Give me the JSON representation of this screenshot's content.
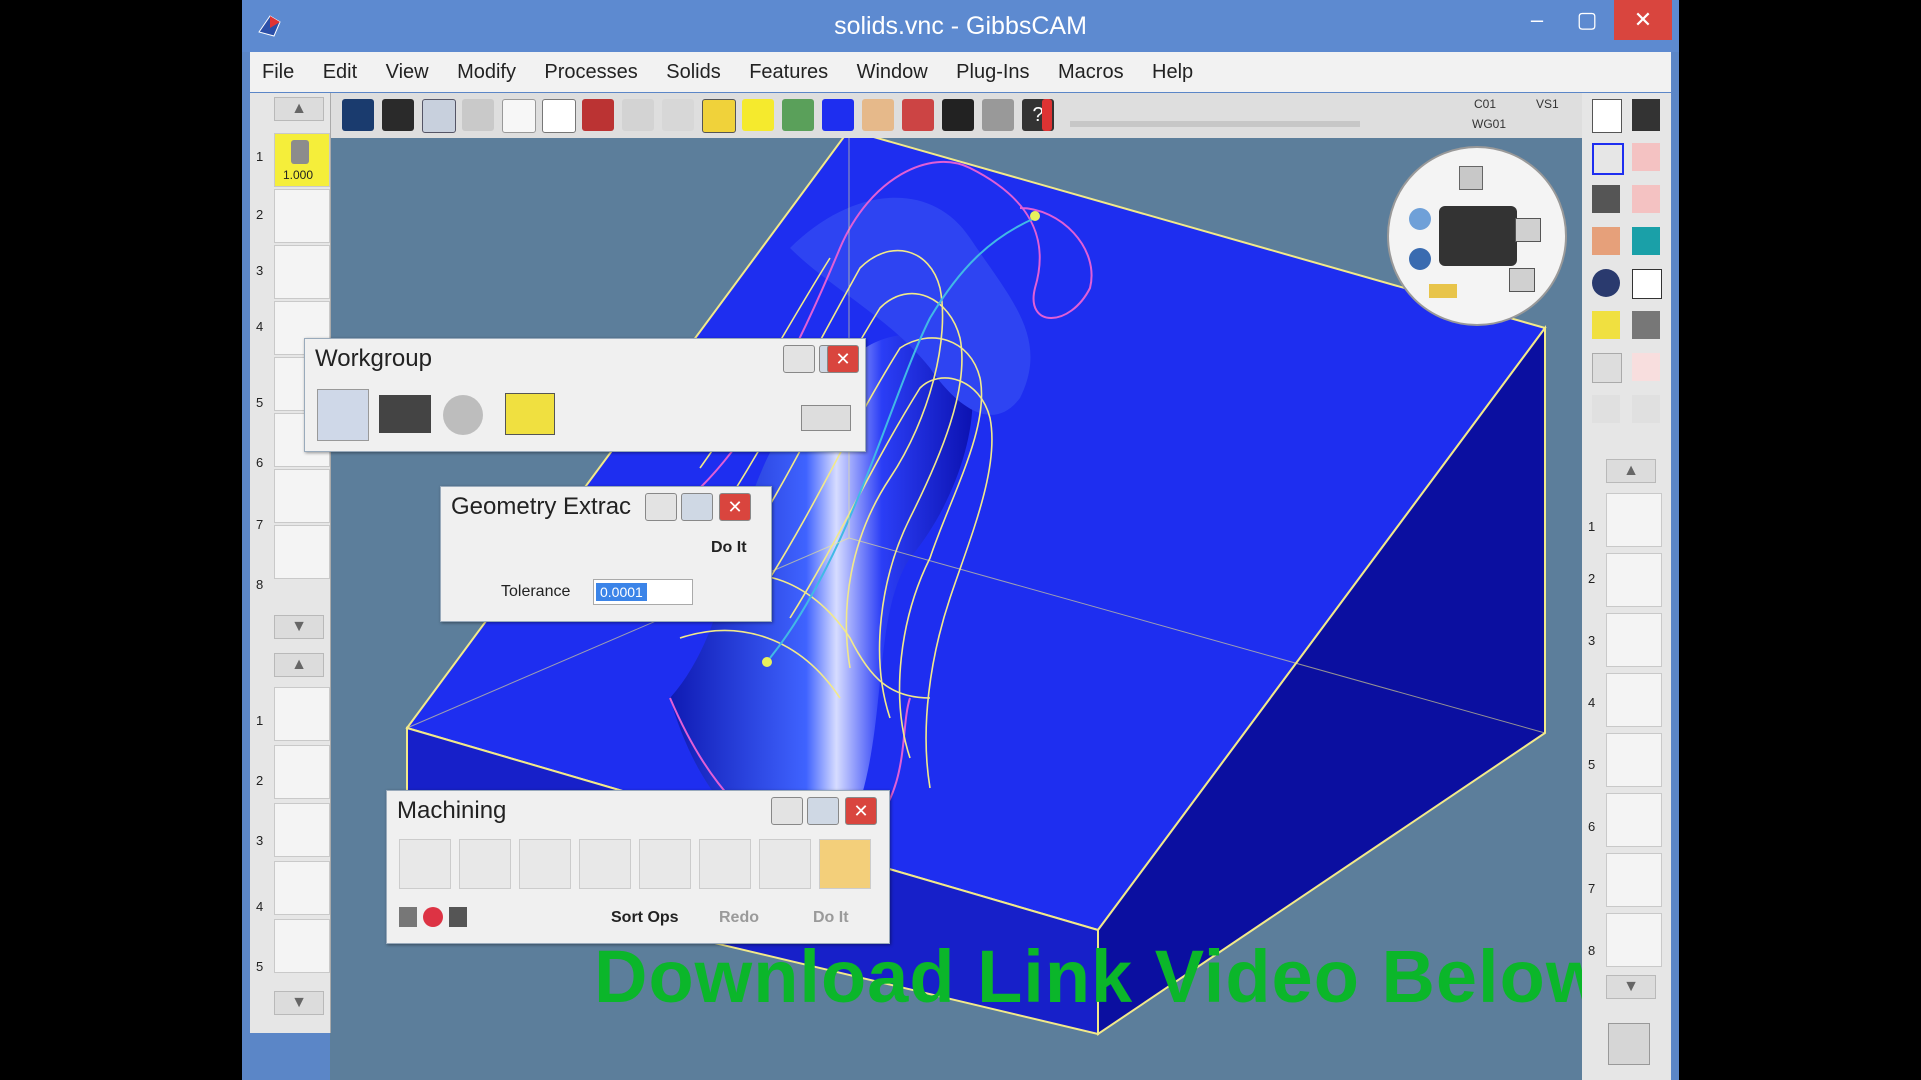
{
  "window": {
    "title": "solids.vnc - GibbsCAM",
    "min_label": "–",
    "max_label": "▢",
    "close_label": "✕"
  },
  "menu": {
    "items": [
      "File",
      "Edit",
      "View",
      "Modify",
      "Processes",
      "Solids",
      "Features",
      "Window",
      "Plug-Ins",
      "Macros",
      "Help"
    ]
  },
  "toolbar": {
    "readout_c": "C01",
    "readout_w": "WG01",
    "readout_v": "VS1"
  },
  "tool_list": {
    "slot_numbers": [
      "1",
      "2",
      "3",
      "4",
      "5",
      "6",
      "7",
      "8"
    ],
    "tool1_value": "1.000"
  },
  "process_list": {
    "slot_numbers": [
      "1",
      "2",
      "3",
      "4",
      "5"
    ]
  },
  "op_list": {
    "slot_numbers": [
      "1",
      "2",
      "3",
      "4",
      "5",
      "6",
      "7",
      "8"
    ]
  },
  "workgroup_panel": {
    "title": "Workgroup",
    "close_label": "✕"
  },
  "geometry_panel": {
    "title": "Geometry Extrac",
    "close_label": "✕",
    "do_it_label": "Do It",
    "tolerance_label": "Tolerance",
    "tolerance_value": "0.0001"
  },
  "machining_panel": {
    "title": "Machining",
    "close_label": "✕",
    "sort_ops_label": "Sort Ops",
    "redo_label": "Redo",
    "do_it_label": "Do It"
  },
  "overlay": {
    "text": "Download Link Video Below"
  },
  "colors": {
    "titlebar": "#5d8ad0",
    "viewport_bg": "#5c7e9b",
    "solid_top": "#1e2ef0",
    "solid_side_dark": "#0b0fa0",
    "solid_side_mid": "#1720c9",
    "toolpath_yellow": "#f2e98a",
    "profile_magenta": "#e15fd6",
    "overlay_green": "#0bb62a"
  }
}
